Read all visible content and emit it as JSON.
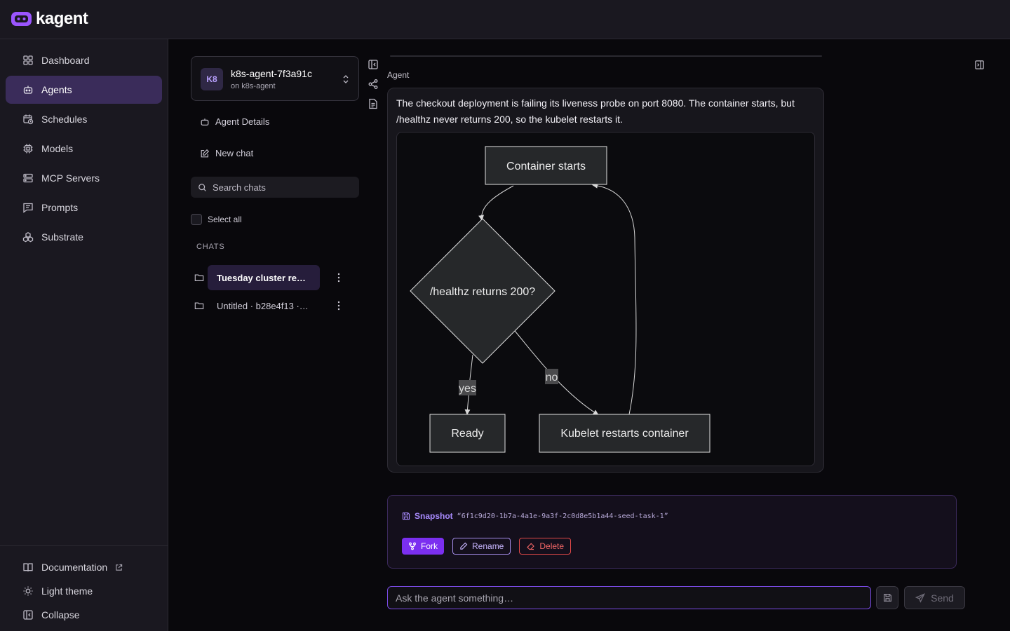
{
  "app": {
    "brand": "kagent",
    "accent": "#7b2ff0"
  },
  "sidebar": {
    "items": [
      {
        "label": "Dashboard",
        "icon": "grid-icon"
      },
      {
        "label": "Agents",
        "icon": "bot-icon",
        "active": true
      },
      {
        "label": "Schedules",
        "icon": "calendar-clock-icon"
      },
      {
        "label": "Models",
        "icon": "cpu-icon"
      },
      {
        "label": "MCP Servers",
        "icon": "server-icon"
      },
      {
        "label": "Prompts",
        "icon": "message-text-icon"
      },
      {
        "label": "Substrate",
        "icon": "boxes-icon"
      }
    ],
    "bottom": {
      "documentation": "Documentation",
      "theme": "Light theme",
      "collapse": "Collapse"
    }
  },
  "chatpanel": {
    "agent": {
      "badge": "K8",
      "name": "k8s-agent-7f3a91c",
      "namespace": "on k8s-agent"
    },
    "agent_details": "Agent Details",
    "new_chat": "New chat",
    "search_placeholder": "Search chats",
    "select_all": "Select all",
    "chats_label": "CHATS",
    "chats": [
      {
        "title": "Tuesday cluster re…",
        "active": true
      },
      {
        "title": "Untitled · b28e4f13 ·…",
        "active": false
      }
    ]
  },
  "message": {
    "role": "Agent",
    "text": "The checkout deployment is failing its liveness probe on port 8080. The container starts, but /healthz never returns 200, so the kubelet restarts it.",
    "diagram": {
      "nodes": {
        "start": "Container starts",
        "decision": "/healthz returns 200?",
        "ready": "Ready",
        "restart": "Kubelet restarts container"
      },
      "edges": {
        "yes": "yes",
        "no": "no"
      }
    }
  },
  "snapshot": {
    "label": "Snapshot",
    "id": "“6f1c9d20-1b7a-4a1e-9a3f-2c0d8e5b1a44-seed-task-1”",
    "fork": "Fork",
    "rename": "Rename",
    "delete": "Delete"
  },
  "composer": {
    "placeholder": "Ask the agent something…",
    "send": "Send"
  }
}
